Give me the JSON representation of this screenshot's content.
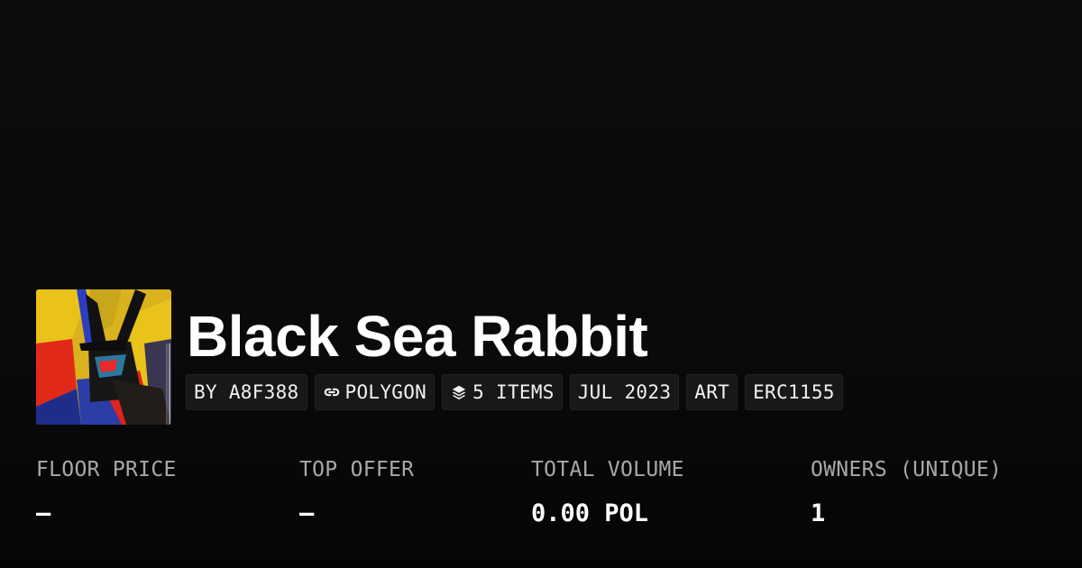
{
  "collection": {
    "title": "Black Sea Rabbit",
    "avatar_alt": "collection-avatar"
  },
  "tags": [
    {
      "label": "BY A8F388",
      "icon": null
    },
    {
      "label": "POLYGON",
      "icon": "chain-link-icon"
    },
    {
      "label": "5 ITEMS",
      "icon": "layers-icon"
    },
    {
      "label": "JUL 2023",
      "icon": null
    },
    {
      "label": "ART",
      "icon": null
    },
    {
      "label": "ERC1155",
      "icon": null
    }
  ],
  "stats": [
    {
      "label": "FLOOR PRICE",
      "value": "–"
    },
    {
      "label": "TOP OFFER",
      "value": "–"
    },
    {
      "label": "TOTAL VOLUME",
      "value": "0.00 POL"
    },
    {
      "label": "OWNERS (UNIQUE)",
      "value": "1"
    }
  ],
  "colors": {
    "background": "#0a0a0a",
    "text": "#ffffff",
    "muted": "#a8a8a8",
    "tag_bg": "#181818"
  }
}
